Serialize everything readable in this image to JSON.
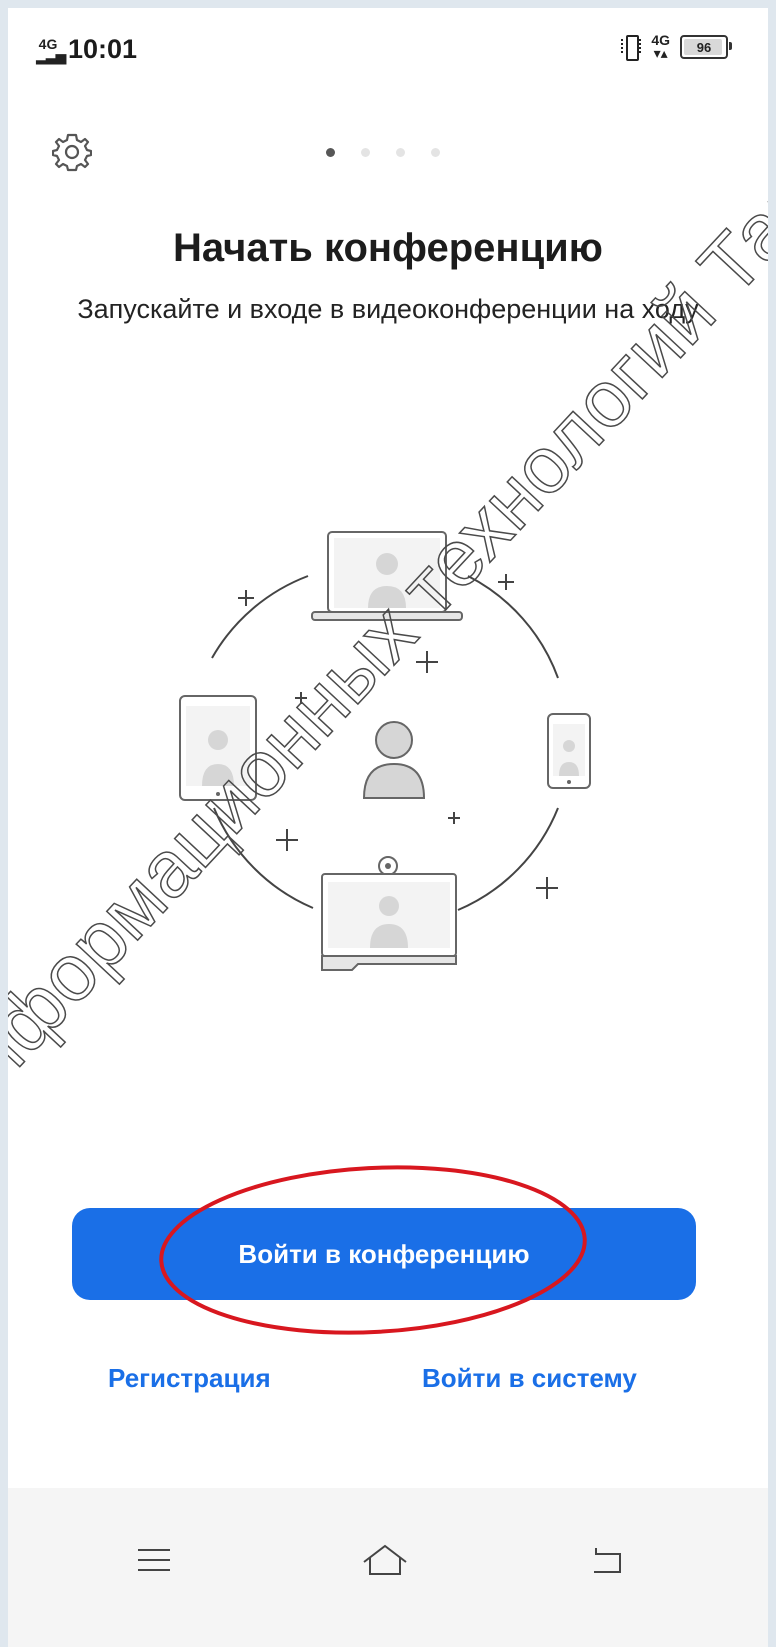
{
  "status_bar": {
    "network_left": "4G",
    "time": "10:01",
    "network_right": "4G",
    "battery": "96"
  },
  "onboarding": {
    "page_indicator": {
      "total": 4,
      "active": 1
    },
    "title": "Начать конференцию",
    "subtitle": "Запускайте и входе в видеоконференции на ходу"
  },
  "actions": {
    "join_button": "Войти в конференцию",
    "register_link": "Регистрация",
    "signin_link": "Войти в систему"
  },
  "watermark": "информационных технологий Тарг",
  "annotation": {
    "color": "#d8171f"
  },
  "colors": {
    "accent": "#1a6fe7"
  },
  "nav_bar": {
    "icons": [
      "menu-icon",
      "home-icon",
      "back-icon"
    ]
  }
}
